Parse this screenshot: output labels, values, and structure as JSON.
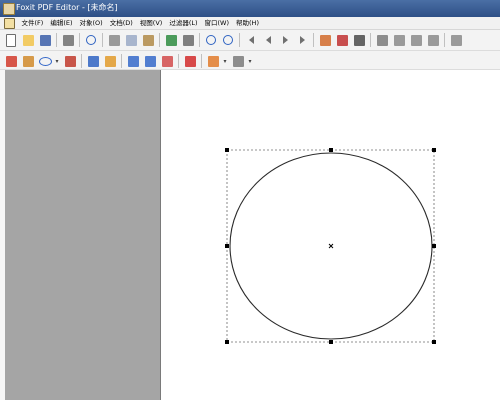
{
  "window": {
    "title": "Foxit PDF Editor - [未命名]"
  },
  "menubar": {
    "items": [
      {
        "label": "文件(F)"
      },
      {
        "label": "编辑(E)"
      },
      {
        "label": "对象(O)"
      },
      {
        "label": "文档(D)"
      },
      {
        "label": "视图(V)"
      },
      {
        "label": "过滤器(L)"
      },
      {
        "label": "窗口(W)"
      },
      {
        "label": "帮助(H)"
      }
    ]
  },
  "toolbar_main": {
    "groups": [
      [
        "new-icon",
        "open-icon",
        "save-icon"
      ],
      [
        "print-icon"
      ],
      [
        "info-icon"
      ],
      [
        "cut-icon",
        "copy-icon",
        "paste-icon"
      ],
      [
        "undo-icon",
        "redo-icon"
      ],
      [
        "zoom-in-icon",
        "zoom-out-icon"
      ],
      [
        "first-page-icon",
        "prev-page-icon",
        "next-page-icon",
        "last-page-icon"
      ],
      [
        "page-properties-icon",
        "rotate-icon",
        "delete-page-icon"
      ],
      [
        "keyboard-icon",
        "grid-icon",
        "layout-icon",
        "thumbnail-icon"
      ],
      [
        "export-icon"
      ]
    ]
  },
  "toolbar_objects": {
    "groups": [
      [
        "text-tool-icon",
        "shape-tool-icon",
        "ellipse-tool-icon",
        "fill-icon"
      ],
      [
        "image-tool-icon",
        "image-edit-icon"
      ],
      [
        "object-list-icon",
        "align-icon",
        "distribute-icon"
      ],
      [
        "delete-object-icon"
      ],
      [
        "color-picker-icon",
        "line-style-icon"
      ]
    ]
  },
  "canvas": {
    "selected_object": "ellipse"
  }
}
